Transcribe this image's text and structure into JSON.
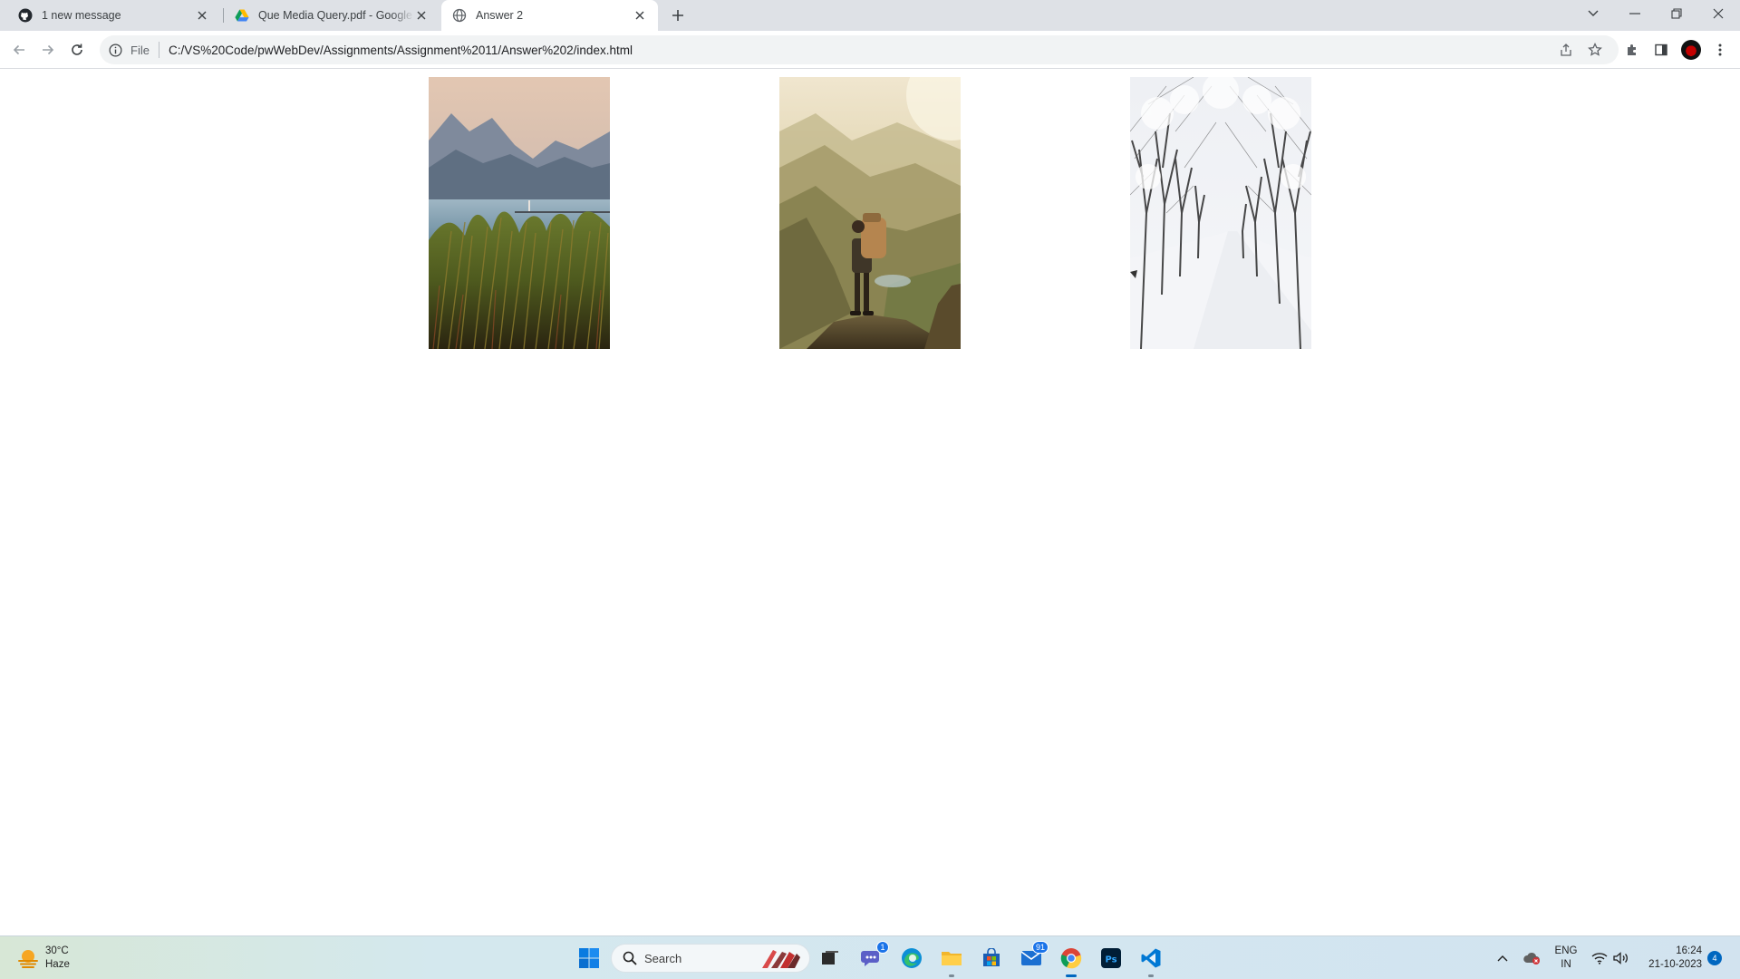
{
  "browser": {
    "tabs": [
      {
        "title": "1 new message",
        "icon": "github-icon",
        "active": false
      },
      {
        "title": "Que Media Query.pdf - Google Drive",
        "icon": "google-drive-icon",
        "active": false
      },
      {
        "title": "Answer 2",
        "icon": "globe-icon",
        "active": true
      }
    ],
    "address_bar": {
      "scheme_label": "File",
      "url": "C:/VS%20Code/pwWebDev/Assignments/Assignment%2011/Answer%202/index.html"
    }
  },
  "page": {
    "images": [
      {
        "subject": "lake with reeds and mountains"
      },
      {
        "subject": "hiker with backpack on mountain cliff"
      },
      {
        "subject": "snowy road between frosted trees"
      }
    ]
  },
  "taskbar": {
    "weather": {
      "temp": "30°C",
      "condition": "Haze"
    },
    "search_label": "Search",
    "teams_badge": "1",
    "mail_badge": "91",
    "language": {
      "line1": "ENG",
      "line2": "IN"
    },
    "clock": {
      "time": "16:24",
      "date": "21-10-2023"
    },
    "notification_count": "4"
  },
  "colors": {
    "tabstrip_bg": "#dee1e6",
    "accent": "#0067c0",
    "chrome_blue": "#1a73e8"
  }
}
